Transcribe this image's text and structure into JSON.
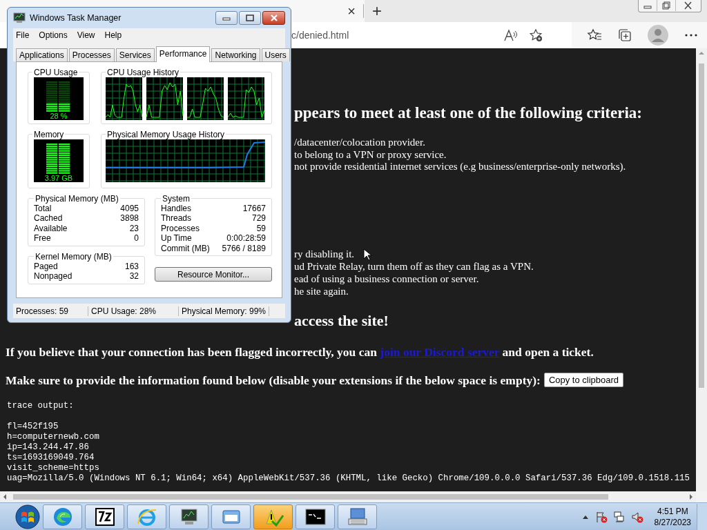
{
  "browser": {
    "tab_close": "×",
    "new_tab": "+",
    "address": "c/denied.html",
    "page": {
      "criteria_heading": "ppears to meet at least one of the following criteria:",
      "criteria": [
        "/datacenter/colocation provider.",
        "to belong to a VPN or proxy service.",
        "not provide residential internet services (e.g business/enterprise-only networks)."
      ],
      "steps": [
        "ry disabling it.",
        "ud Private Relay, turn them off as they can flag as a VPN.",
        "ead of using a business connection or server.",
        "he site again."
      ],
      "still_heading": "access the site!",
      "discord_paragraph": {
        "before": "If you believe that your connection has been flagged incorrectly, you can ",
        "link": "join our Discord server",
        "after": " and open a ticket."
      },
      "info_paragraph": "Make sure to provide the information found below (disable your extensions if the below space is empty):",
      "copy_button": "Copy to clipboard",
      "trace": [
        "trace output:",
        "fl=452f195",
        "h=computernewb.com",
        "ip=143.244.47.86",
        "ts=1693169049.764",
        "visit_scheme=https",
        "uag=Mozilla/5.0 (Windows NT 6.1; Win64; x64) AppleWebKit/537.36 (KHTML, like Gecko) Chrome/109.0.0.0 Safari/537.36 Edg/109.0.1518.115"
      ]
    }
  },
  "task_manager": {
    "title": "Windows Task Manager",
    "menu": [
      "File",
      "Options",
      "View",
      "Help"
    ],
    "tabs": [
      {
        "label": "Applications",
        "selected": false
      },
      {
        "label": "Processes",
        "selected": false
      },
      {
        "label": "Services",
        "selected": false
      },
      {
        "label": "Performance",
        "selected": true
      },
      {
        "label": "Networking",
        "selected": false
      },
      {
        "label": "Users",
        "selected": false
      }
    ],
    "cpu_usage": {
      "label": "CPU Usage",
      "reading": "28 %",
      "level": 0.28
    },
    "cpu_history": {
      "label": "CPU Usage History"
    },
    "memory": {
      "label": "Memory",
      "reading": "3.97 GB",
      "level": 0.99
    },
    "memory_history": {
      "label": "Physical Memory Usage History"
    },
    "physical_memory": {
      "title": "Physical Memory (MB)",
      "rows": [
        {
          "label": "Total",
          "value": "4095"
        },
        {
          "label": "Cached",
          "value": "3898"
        },
        {
          "label": "Available",
          "value": "23"
        },
        {
          "label": "Free",
          "value": "0"
        }
      ]
    },
    "kernel_memory": {
      "title": "Kernel Memory (MB)",
      "rows": [
        {
          "label": "Paged",
          "value": "163"
        },
        {
          "label": "Nonpaged",
          "value": "32"
        }
      ]
    },
    "system": {
      "title": "System",
      "rows": [
        {
          "label": "Handles",
          "value": "17667"
        },
        {
          "label": "Threads",
          "value": "729"
        },
        {
          "label": "Processes",
          "value": "59"
        },
        {
          "label": "Up Time",
          "value": "0:00:28:59"
        },
        {
          "label": "Commit (MB)",
          "value": "5766 / 8189"
        }
      ]
    },
    "resource_monitor_button": "Resource Monitor...",
    "status": [
      "Processes: 59",
      "CPU Usage: 28%",
      "Physical Memory: 99%"
    ]
  },
  "taskbar": {
    "apps": [
      {
        "kind": "edge",
        "highlighted": false
      },
      {
        "kind": "sevenzip",
        "highlighted": false
      },
      {
        "kind": "ie",
        "highlighted": false
      },
      {
        "kind": "taskmgr",
        "highlighted": false
      },
      {
        "kind": "window",
        "highlighted": false
      },
      {
        "kind": "actioncenter",
        "highlighted": true
      },
      {
        "kind": "cmd",
        "highlighted": false
      },
      {
        "kind": "keyboard",
        "highlighted": false
      }
    ],
    "clock": {
      "time": "4:51 PM",
      "date": "8/27/2023"
    }
  }
}
